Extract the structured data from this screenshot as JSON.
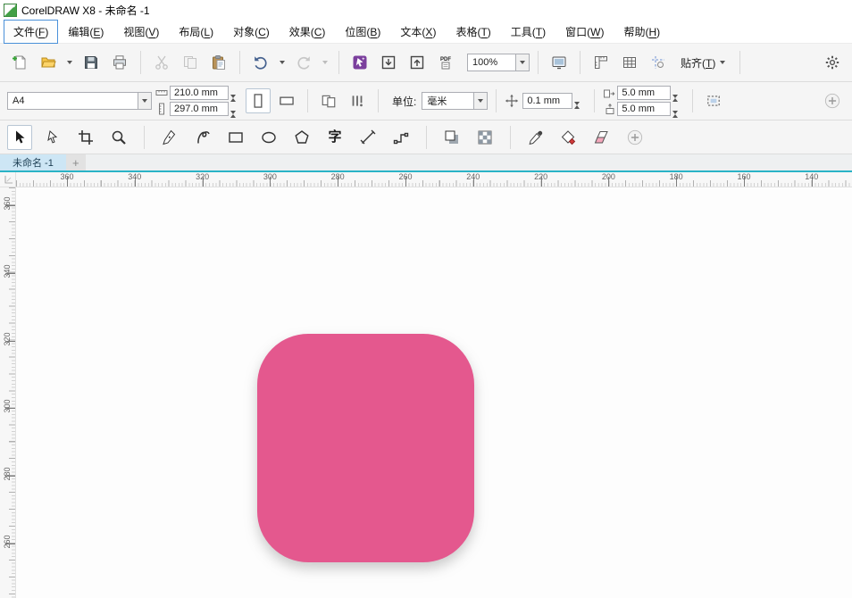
{
  "window": {
    "title": "CorelDRAW X8 - 未命名 -1"
  },
  "menubar": {
    "active_index": 0,
    "items": [
      "文件(F)",
      "编辑(E)",
      "视图(V)",
      "布局(L)",
      "对象(C)",
      "效果(C)",
      "位图(B)",
      "文本(X)",
      "表格(T)",
      "工具(T)",
      "窗口(W)",
      "帮助(H)"
    ]
  },
  "standard_toolbar": {
    "zoom_value": "100%",
    "snap_label": "贴齐(T)",
    "pdf_label": "PDF",
    "icons": [
      "new-document",
      "open",
      "save",
      "print",
      "cut",
      "copy",
      "paste",
      "undo",
      "redo",
      "search-content",
      "import",
      "export",
      "publish-to-pdf",
      "zoom-levels",
      "full-screen-preview",
      "show-rulers",
      "show-grid",
      "show-guidelines",
      "snap-to",
      "options-gear"
    ]
  },
  "property_bar": {
    "page_size_preset": "A4",
    "page_width_value": "210.0 mm",
    "page_height_value": "297.0 mm",
    "units_label": "单位:",
    "units_value": "毫米",
    "nudge_value": "0.1 mm",
    "duplicate_x_value": "5.0 mm",
    "duplicate_y_value": "5.0 mm",
    "icons": [
      "page-width",
      "page-height",
      "portrait",
      "landscape",
      "apply-to-all-pages",
      "apply-to-current-page",
      "nudge-offset",
      "duplicate-distance-x",
      "duplicate-distance-y",
      "treat-as-filled",
      "quick-customize-plus"
    ]
  },
  "toolbox": {
    "active_tool": "pick",
    "text_tool_glyph": "字",
    "tools": [
      "pick",
      "shape",
      "crop",
      "zoom",
      "pen",
      "artistic-media",
      "rectangle",
      "ellipse",
      "polygon",
      "text",
      "parallel-dimension",
      "connector",
      "drop-shadow",
      "transparency",
      "color-eyedropper",
      "interactive-fill",
      "eraser",
      "quick-customize-plus"
    ]
  },
  "document_tabs": {
    "tabs": [
      {
        "label": "未命名 -1",
        "active": true
      }
    ],
    "new_tab_label": "+"
  },
  "rulers": {
    "horizontal_labels": [
      "360",
      "340",
      "320",
      "300",
      "280",
      "260",
      "240",
      "220",
      "200",
      "180",
      "160",
      "140"
    ],
    "vertical_labels": [
      "360",
      "340",
      "320",
      "300",
      "280",
      "260"
    ]
  },
  "canvas": {
    "shape": {
      "type": "rounded-square",
      "fill": "#e4588e"
    }
  },
  "colors": {
    "accent_tab_line": "#2ab3c6",
    "toolbar_bg": "#f5f5f5",
    "shape_fill": "#e4588e",
    "active_menu_border": "#4a90d9"
  }
}
